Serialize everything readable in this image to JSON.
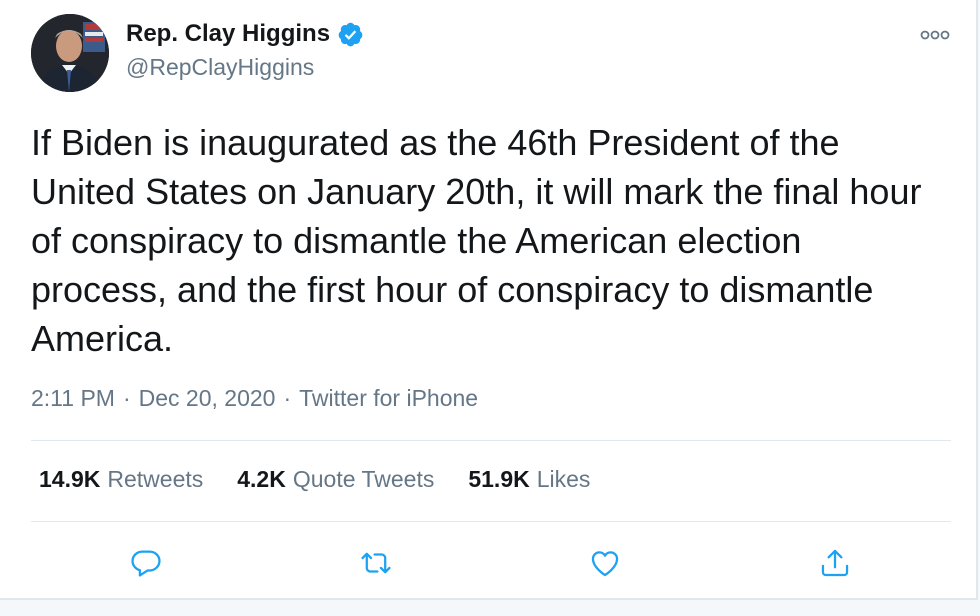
{
  "author": {
    "display_name": "Rep. Clay Higgins",
    "handle": "@RepClayHiggins",
    "verified": true
  },
  "tweet": {
    "text": "If Biden is inaugurated as the 46th President of the\nUnited States on January 20th, it will mark the final hour\nof conspiracy to dismantle the American election\nprocess, and the first hour of conspiracy to dismantle\nAmerica.",
    "time": "2:11 PM",
    "separator": "·",
    "date": "Dec 20, 2020",
    "source": "Twitter for iPhone"
  },
  "stats": [
    {
      "count": "14.9K",
      "label": "Retweets"
    },
    {
      "count": "4.2K",
      "label": "Quote Tweets"
    },
    {
      "count": "51.9K",
      "label": "Likes"
    }
  ],
  "actions": [
    "reply-icon",
    "retweet-icon",
    "like-icon",
    "share-icon"
  ],
  "colors": {
    "verified_badge": "#1da1f2",
    "icon_gray": "#657786",
    "action_blue": "#1da1f2",
    "text": "#14171a",
    "divider": "#e1e8ed"
  }
}
